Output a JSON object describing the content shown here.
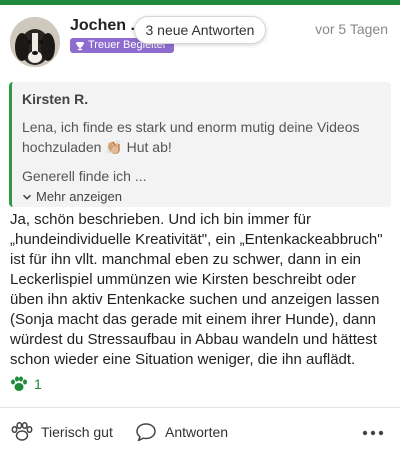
{
  "post": {
    "author_name": "Jochen .",
    "badge_label": "Treuer Begleiter",
    "new_replies_pill": "3 neue Antworten",
    "timestamp": "vor 5 Tagen"
  },
  "quote": {
    "author": "Kirsten R.",
    "text": "Lena, ich finde es stark und enorm mutig deine Videos hochzuladen 👏🏼 Hut ab!",
    "preview": "Generell finde ich ...",
    "expand_label": "Mehr anzeigen"
  },
  "body": {
    "text": "Ja, schön beschrieben. Und ich bin immer für „hundeindividuelle Kreativität\", ein „Entenkackeabbruch\" ist für ihn vllt. manchmal eben zu schwer, dann in ein Leckerlispiel ummünzen wie Kirsten beschreibt oder üben ihn aktiv Entenkacke suchen und anzeigen lassen (Sonja macht das gerade mit einem ihrer Hunde), dann würdest du Stressaufbau in Abbau wandeln und hättest schon wieder eine Situation weniger, die ihn auflädt."
  },
  "reactions": {
    "count": "1",
    "icon": "paw-icon"
  },
  "actions": {
    "like_label": "Tierisch gut",
    "reply_label": "Antworten",
    "more_icon": "more-dots-icon"
  },
  "colors": {
    "brand_green": "#1f8a3b",
    "badge_purple": "#8e6ccf"
  }
}
